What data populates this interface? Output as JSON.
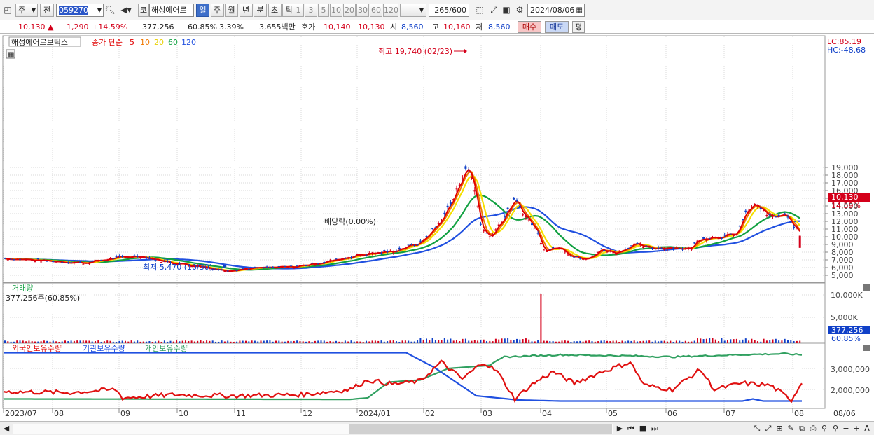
{
  "toolbar": {
    "period_select": "주",
    "adjust_select": "전",
    "code_value": "059270",
    "code_prefix": "코",
    "name_value": "해성에어로",
    "period_tabs": [
      "일",
      "주",
      "월",
      "년",
      "분",
      "초",
      "틱"
    ],
    "active_period": "일",
    "interval_tabs": [
      "1",
      "3",
      "5",
      "10",
      "20",
      "30",
      "60",
      "120"
    ],
    "count_value": "265",
    "count_total": "/600",
    "date_value": "2024/08/06"
  },
  "quote": {
    "price": "10,130",
    "price_arrow": "▲",
    "change": "1,290",
    "change_pct": "+14.59%",
    "volume": "377,256",
    "vol_ratio": "60.85%",
    "turnover": "3.39%",
    "amount": "3,655백만",
    "hoga_label": "호가",
    "ask": "10,140",
    "bid": "10,130",
    "open_label": "시",
    "open": "8,560",
    "high_label": "고",
    "high": "10,160",
    "low_label": "저",
    "low": "8,560",
    "buy_button": "매수",
    "sell_button": "매도",
    "avg_button": "평"
  },
  "price_panel": {
    "title": "해성에어로보틱스",
    "ma_label": "종가 단순",
    "ma_periods": [
      "5",
      "10",
      "20",
      "60",
      "120"
    ],
    "lc": "LC:85.19",
    "hc": "HC:-48.68",
    "high_annotation": "최고 19,740 (02/23)",
    "low_annotation": "최저 5,470 (10/30)",
    "dividend_annotation": "배당락(0.00%)",
    "current_price_tag": "10,130",
    "current_pct_tag": "14.59%",
    "y_ticks": [
      "19,000",
      "18,000",
      "17,000",
      "16,000",
      "15,000",
      "14,000",
      "13,000",
      "12,000",
      "11,000",
      "10,000",
      "9,000",
      "8,000",
      "7,000",
      "6,000",
      "5,000"
    ]
  },
  "volume_panel": {
    "title": "거래량",
    "value": "377,256주(60.85%)",
    "y_ticks": [
      "10,000K",
      "5,000K"
    ],
    "current_tag": "377,256",
    "current_pct": "60.85%"
  },
  "holder_panel": {
    "series": [
      "외국인보유수량",
      "기관보유수량",
      "개인보유수량"
    ],
    "y_ticks": [
      "3,000,000",
      "2,000,000"
    ]
  },
  "x_axis": [
    "2023/07",
    "08",
    "09",
    "10",
    "11",
    "12",
    "2024/01",
    "02",
    "03",
    "04",
    "05",
    "06",
    "07",
    "08",
    "08/06"
  ],
  "colors": {
    "up": "#d4001a",
    "down": "#1040c8",
    "ma5": "#e00000",
    "ma10": "#f07800",
    "ma20": "#f5e000",
    "ma60": "#10a040",
    "ma120": "#2050e0",
    "foreign": "#e01010",
    "institution": "#2050e0",
    "individual": "#30a060"
  },
  "chart_data": [
    {
      "type": "line",
      "title": "해성에어로보틱스",
      "x": [
        "2023/07",
        "08",
        "09",
        "10",
        "11",
        "12",
        "2024/01",
        "02",
        "03",
        "04",
        "05",
        "06",
        "07",
        "08"
      ],
      "series": [
        {
          "name": "종가",
          "values": [
            7100,
            6600,
            7400,
            6600,
            5800,
            6100,
            7700,
            16500,
            10500,
            8200,
            8300,
            8500,
            13000,
            10130
          ]
        }
      ],
      "ylim": [
        4500,
        20000
      ],
      "annotations": [
        "최고 19,740 (02/23)",
        "최저 5,470 (10/30)",
        "배당락(0.00%)"
      ]
    },
    {
      "type": "bar",
      "title": "거래량",
      "x": [
        "2023/07",
        "08",
        "09",
        "10",
        "11",
        "12",
        "2024/01",
        "02",
        "03",
        "04",
        "05",
        "06",
        "07",
        "08"
      ],
      "series": [
        {
          "name": "거래량",
          "values": [
            300,
            250,
            900,
            300,
            200,
            250,
            500,
            1500,
            1400,
            1200,
            700,
            800,
            1200,
            377
          ]
        }
      ],
      "ylim": [
        0,
        11000
      ]
    },
    {
      "type": "line",
      "x": [
        "2023/07",
        "08",
        "09",
        "10",
        "11",
        "12",
        "2024/01",
        "02",
        "03",
        "04",
        "05",
        "06",
        "07",
        "08"
      ],
      "series": [
        {
          "name": "외국인보유수량",
          "values": [
            1880000,
            1800000,
            1850000,
            1750000,
            1700000,
            1720000,
            2450000,
            2350000,
            2900000,
            2000000,
            2300000,
            1900000,
            2000000,
            2350000
          ]
        },
        {
          "name": "기관보유수량",
          "values": [
            3750000,
            3750000,
            3750000,
            3750000,
            3750000,
            3750000,
            3750000,
            3750000,
            1700000,
            1500000,
            1450000,
            1450000,
            1450000,
            1450000
          ]
        },
        {
          "name": "개인보유수량",
          "values": [
            1570000,
            1550000,
            1550000,
            1540000,
            1530000,
            1530000,
            1550000,
            2900000,
            3200000,
            3650000,
            3600000,
            3550000,
            3650000,
            3650000
          ]
        }
      ],
      "ylim": [
        1300000,
        3900000
      ]
    }
  ]
}
